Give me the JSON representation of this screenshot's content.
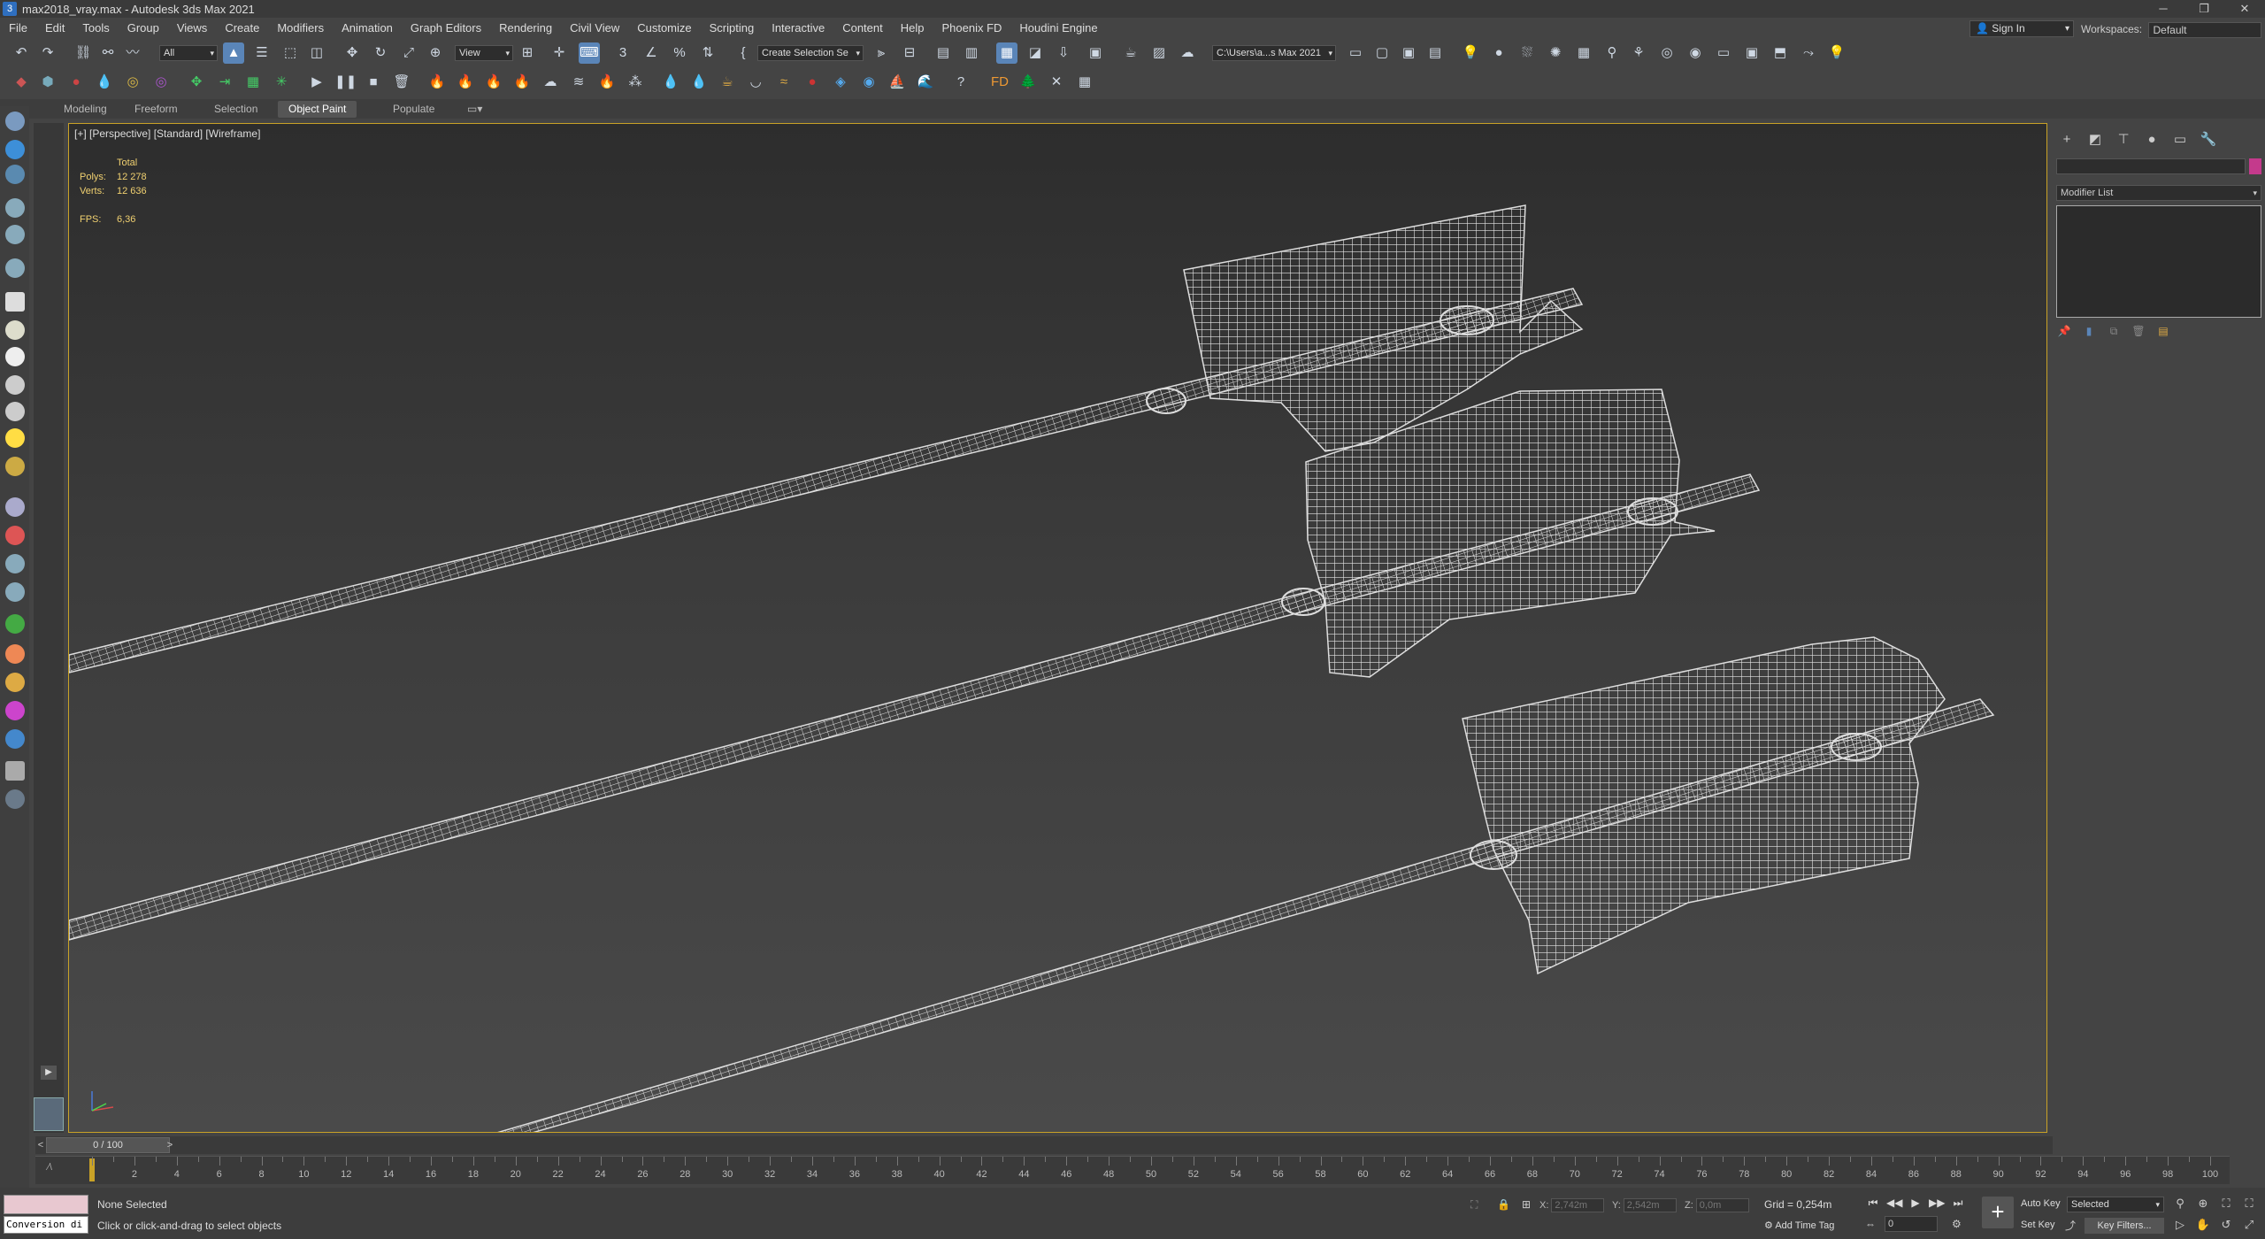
{
  "window": {
    "title": "max2018_vray.max - Autodesk 3ds Max 2021",
    "minimize": "─",
    "restore": "❐",
    "close": "✕"
  },
  "menu": [
    "File",
    "Edit",
    "Tools",
    "Group",
    "Views",
    "Create",
    "Modifiers",
    "Animation",
    "Graph Editors",
    "Rendering",
    "Civil View",
    "Customize",
    "Scripting",
    "Interactive",
    "Content",
    "Help",
    "Phoenix FD",
    "Houdini Engine"
  ],
  "signin": {
    "label": "Sign In"
  },
  "workspaces": {
    "label": "Workspaces:",
    "value": "Default"
  },
  "toolbar": {
    "selection_filter": "All",
    "ref_coord": "View",
    "named_selection": "Create Selection Se",
    "project_path": "C:\\Users\\a...s Max 2021"
  },
  "ribbon": {
    "tabs": [
      "Modeling",
      "Freeform",
      "Selection",
      "Object Paint",
      "Populate"
    ],
    "active": "Object Paint"
  },
  "viewport": {
    "label": "[+] [Perspective] [Standard] [Wireframe]",
    "stats": {
      "header": "Total",
      "polys_label": "Polys:",
      "polys": "12 278",
      "verts_label": "Verts:",
      "verts": "12 636",
      "fps_label": "FPS:",
      "fps": "6,36"
    }
  },
  "command_panel": {
    "modifier_list": "Modifier List"
  },
  "time": {
    "slider": "0 / 100",
    "ticks": [
      "2",
      "4",
      "6",
      "8",
      "10",
      "12",
      "14",
      "16",
      "18",
      "20",
      "22",
      "24",
      "26",
      "28",
      "30",
      "32",
      "34",
      "36",
      "38",
      "40",
      "42",
      "44",
      "46",
      "48",
      "50",
      "52",
      "54",
      "56",
      "58",
      "60",
      "62",
      "64",
      "66",
      "68",
      "70",
      "72",
      "74",
      "76",
      "78",
      "80",
      "82",
      "84",
      "86",
      "88",
      "90",
      "92",
      "94",
      "96",
      "98",
      "100"
    ]
  },
  "status": {
    "selection": "None Selected",
    "prompt": "Click or click-and-drag to select objects",
    "maxscript": "Conversion di",
    "x_label": "X:",
    "x": "2,742m",
    "y_label": "Y:",
    "y": "2,542m",
    "z_label": "Z:",
    "z": "0,0m",
    "grid": "Grid = 0,254m",
    "add_time_tag": "Add Time Tag",
    "auto_key": "Auto Key",
    "set_key": "Set Key",
    "key_mode": "Selected",
    "key_filters": "Key Filters...",
    "frame": "0"
  },
  "colors": {
    "viewport_border": "#c9a227",
    "active_tool": "#5a85b8",
    "stats_text": "#f0d070",
    "object_color": "#c43a8c"
  }
}
